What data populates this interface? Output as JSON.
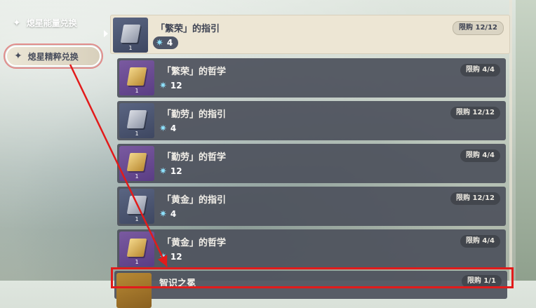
{
  "sidebar": {
    "tabs": [
      {
        "label": "熄星能量兑换"
      },
      {
        "label": "熄星精粹兑换"
      }
    ]
  },
  "shop": {
    "items": [
      {
        "title": "「繁荣」的指引",
        "price": "4",
        "limit": "限购 12/12",
        "qty": "1",
        "icon": "guide-book-icon",
        "tier": "silver"
      },
      {
        "title": "「繁荣」的哲学",
        "price": "12",
        "limit": "限购 4/4",
        "qty": "1",
        "icon": "philosophy-book-icon",
        "tier": "gold"
      },
      {
        "title": "「勤劳」的指引",
        "price": "4",
        "limit": "限购 12/12",
        "qty": "1",
        "icon": "guide-book-icon",
        "tier": "silver"
      },
      {
        "title": "「勤劳」的哲学",
        "price": "12",
        "limit": "限购 4/4",
        "qty": "1",
        "icon": "philosophy-book-icon",
        "tier": "gold"
      },
      {
        "title": "「黄金」的指引",
        "price": "4",
        "limit": "限购 12/12",
        "qty": "1",
        "icon": "guide-book-icon",
        "tier": "silver"
      },
      {
        "title": "「黄金」的哲学",
        "price": "12",
        "limit": "限购 4/4",
        "qty": "1",
        "icon": "philosophy-book-icon",
        "tier": "gold"
      },
      {
        "title": "智识之冕",
        "price": "",
        "limit": "限购 1/1",
        "qty": "",
        "icon": "crown-icon",
        "tier": "gold"
      }
    ],
    "currency_icon": "star-gem-icon"
  },
  "colors": {
    "highlight": "#e21b1b",
    "row_bg": "#4e525c",
    "selected_bg": "#ede6d4",
    "gem": "#8fe3ff"
  }
}
